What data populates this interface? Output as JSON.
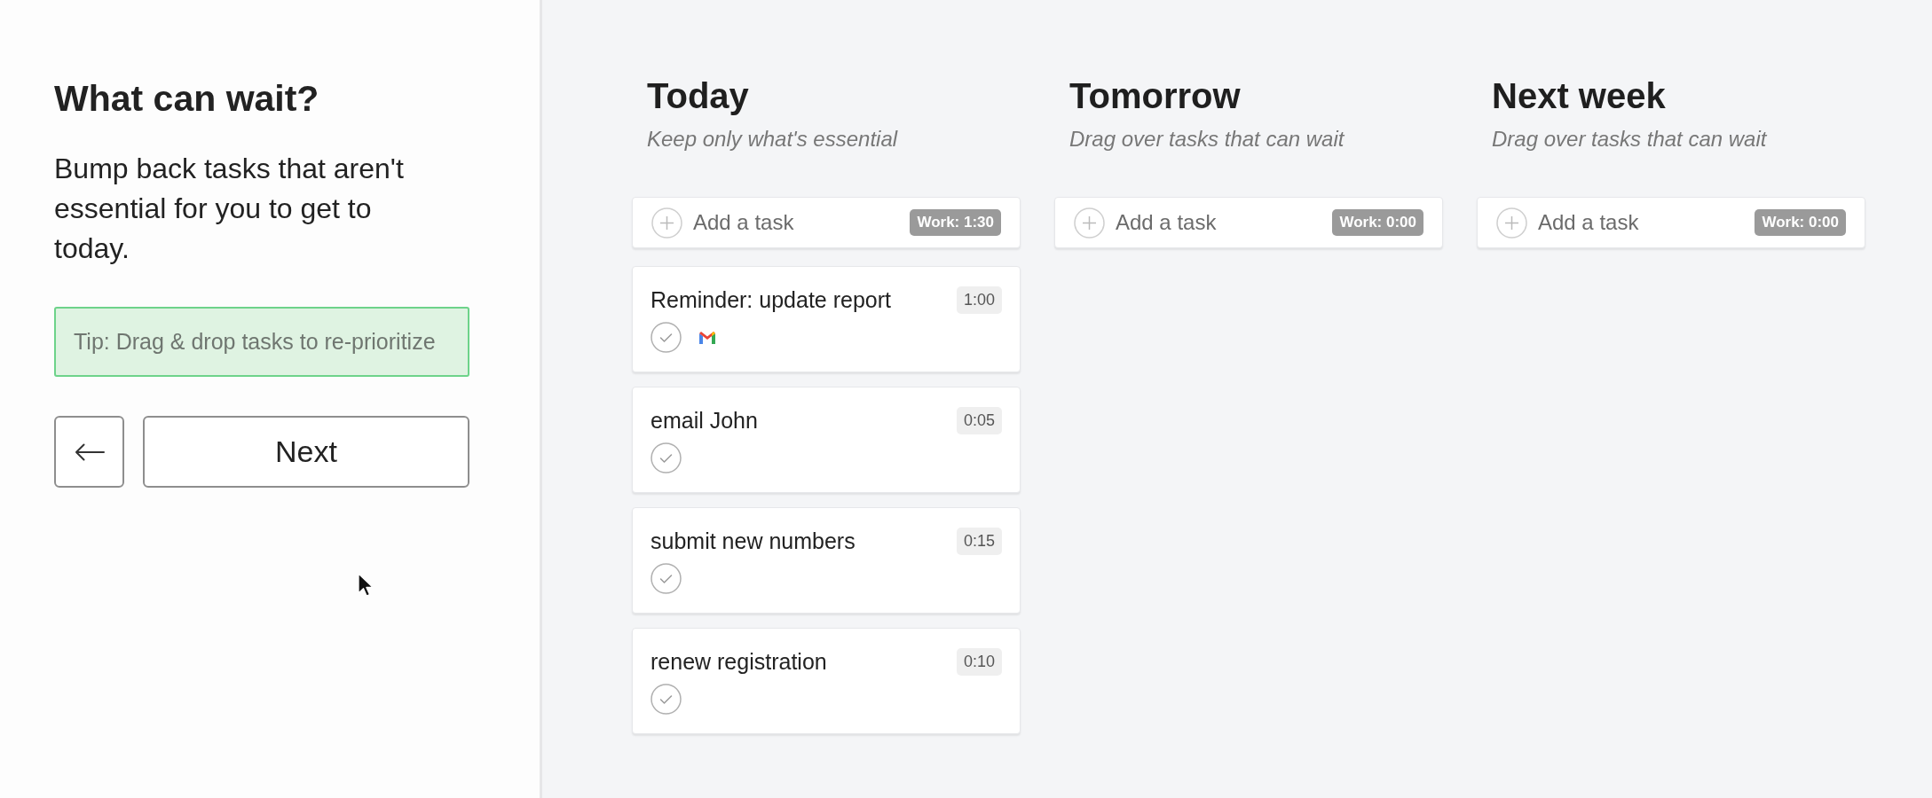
{
  "sidebar": {
    "title": "What can wait?",
    "description": "Bump back tasks that aren't essential for you to get to today.",
    "tip": "Tip: Drag & drop tasks to re-prioritize",
    "next_button": "Next"
  },
  "columns": [
    {
      "title": "Today",
      "subtitle": "Keep only what's essential",
      "add_task": {
        "placeholder": "Add a task"
      },
      "work_total": "Work: 1:30",
      "tasks": [
        {
          "title": "Reminder: update report",
          "duration": "1:00",
          "email_linked": true
        },
        {
          "title": "email John",
          "duration": "0:05",
          "email_linked": false
        },
        {
          "title": "submit new numbers",
          "duration": "0:15",
          "email_linked": false
        },
        {
          "title": "renew registration",
          "duration": "0:10",
          "email_linked": false
        }
      ]
    },
    {
      "title": "Tomorrow",
      "subtitle": "Drag over tasks that can wait",
      "add_task": {
        "placeholder": "Add a task"
      },
      "work_total": "Work: 0:00"
    },
    {
      "title": "Next week",
      "subtitle": "Drag over tasks that can wait",
      "add_task": {
        "placeholder": "Add a task"
      },
      "work_total": "Work: 0:00"
    }
  ]
}
